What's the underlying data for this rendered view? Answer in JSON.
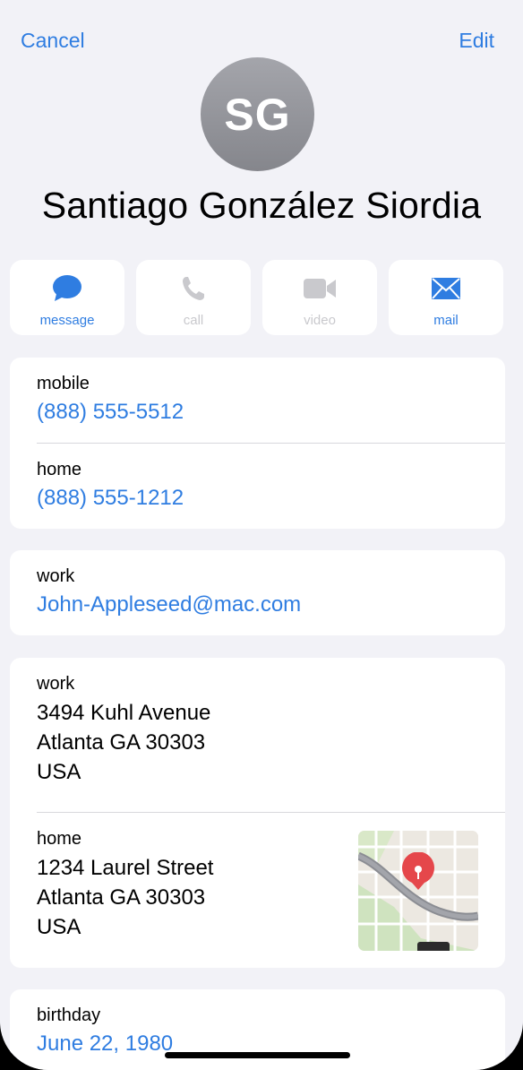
{
  "nav": {
    "cancel_label": "Cancel",
    "edit_label": "Edit"
  },
  "contact": {
    "initials": "SG",
    "name": "Santiago González Siordia"
  },
  "actions": [
    {
      "label": "message",
      "icon": "message-bubble-icon",
      "enabled": true
    },
    {
      "label": "call",
      "icon": "phone-icon",
      "enabled": false
    },
    {
      "label": "video",
      "icon": "video-camera-icon",
      "enabled": false
    },
    {
      "label": "mail",
      "icon": "envelope-icon",
      "enabled": true
    }
  ],
  "phones": [
    {
      "label": "mobile",
      "value": "(888) 555-5512"
    },
    {
      "label": "home",
      "value": "(888) 555-1212"
    }
  ],
  "email": {
    "label": "work",
    "value": "John-Appleseed@mac.com"
  },
  "addresses": [
    {
      "label": "work",
      "line1": "3494 Kuhl Avenue",
      "line2": "Atlanta GA 30303",
      "line3": "USA"
    },
    {
      "label": "home",
      "line1": "1234 Laurel Street",
      "line2": "Atlanta GA 30303",
      "line3": "USA"
    }
  ],
  "birthday": {
    "label": "birthday",
    "value": "June 22, 1980"
  },
  "colors": {
    "accent": "#2f7de1",
    "background": "#f2f2f7",
    "avatar": "#96979d",
    "map_pin": "#e5474b"
  }
}
